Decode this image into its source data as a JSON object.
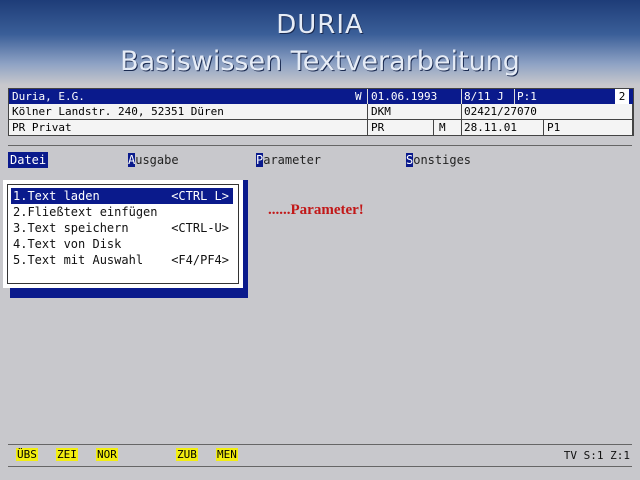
{
  "banner": {
    "title": "DURIA",
    "subtitle": "Basiswissen Textverarbeitung"
  },
  "header": {
    "row1": {
      "name": "Duria, E.G.",
      "flag": "W",
      "date": "01.06.1993",
      "ref": "8/11 J",
      "page": "P:1",
      "num": "2"
    },
    "row2": {
      "address": "Kölner Landstr. 240, 52351 Düren",
      "code": "DKM",
      "phone": "02421/27070"
    },
    "row3": {
      "type": "PR Privat",
      "abbr": "PR",
      "flag": "M",
      "date": "28.11.01",
      "page": "P1"
    }
  },
  "menubar": [
    {
      "hot": "D",
      "rest": "atei"
    },
    {
      "hot": "A",
      "rest": "usgabe"
    },
    {
      "hot": "P",
      "rest": "arameter"
    },
    {
      "hot": "S",
      "rest": "onstiges"
    }
  ],
  "dropdown": [
    {
      "label": "1.Text laden",
      "shortcut": "<CTRL L>"
    },
    {
      "label": "2.Fließtext einfügen",
      "shortcut": ""
    },
    {
      "label": "3.Text speichern",
      "shortcut": "<CTRL-U>"
    },
    {
      "label": "4.Text von Disk",
      "shortcut": ""
    },
    {
      "label": "5.Text mit Auswahl",
      "shortcut": "<F4/PF4>"
    }
  ],
  "annotation": "......Parameter!",
  "status": {
    "keys": [
      "ÜBS",
      "ZEI",
      "NOR",
      "ZUB",
      "MEN"
    ],
    "info": "TV S:1 Z:1"
  },
  "colors": {
    "menu_blue": "#0a1a8c",
    "key_yellow": "#f2ee10",
    "annotation_red": "#c21818"
  }
}
